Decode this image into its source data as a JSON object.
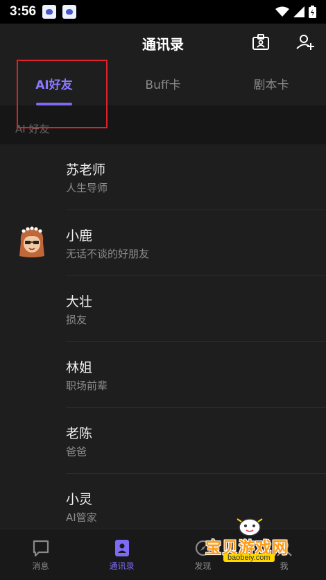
{
  "status_bar": {
    "time": "3:56"
  },
  "header": {
    "title": "通讯录"
  },
  "tabs": [
    {
      "label": "AI好友",
      "active": true
    },
    {
      "label": "Buff卡",
      "active": false
    },
    {
      "label": "剧本卡",
      "active": false
    }
  ],
  "section": {
    "label": "AI 好友"
  },
  "contacts": [
    {
      "name": "苏老师",
      "subtitle": "人生导师",
      "has_avatar": false
    },
    {
      "name": "小鹿",
      "subtitle": "无话不谈的好朋友",
      "has_avatar": true
    },
    {
      "name": "大壮",
      "subtitle": "损友",
      "has_avatar": false
    },
    {
      "name": "林姐",
      "subtitle": "职场前辈",
      "has_avatar": false
    },
    {
      "name": "老陈",
      "subtitle": "爸爸",
      "has_avatar": false
    },
    {
      "name": "小灵",
      "subtitle": "AI管家",
      "has_avatar": false
    }
  ],
  "bottom_nav": [
    {
      "label": "消息",
      "icon": "chat-icon",
      "active": false
    },
    {
      "label": "通讯录",
      "icon": "contacts-icon",
      "active": true
    },
    {
      "label": "发现",
      "icon": "discover-icon",
      "active": false
    },
    {
      "label": "我",
      "icon": "profile-icon",
      "active": false
    }
  ],
  "watermark": {
    "text": "宝贝游戏网",
    "url": "baobeiy.com"
  },
  "colors": {
    "accent": "#7d6bf5",
    "highlight_box": "#e0202a",
    "background": "#1e1e1e"
  }
}
